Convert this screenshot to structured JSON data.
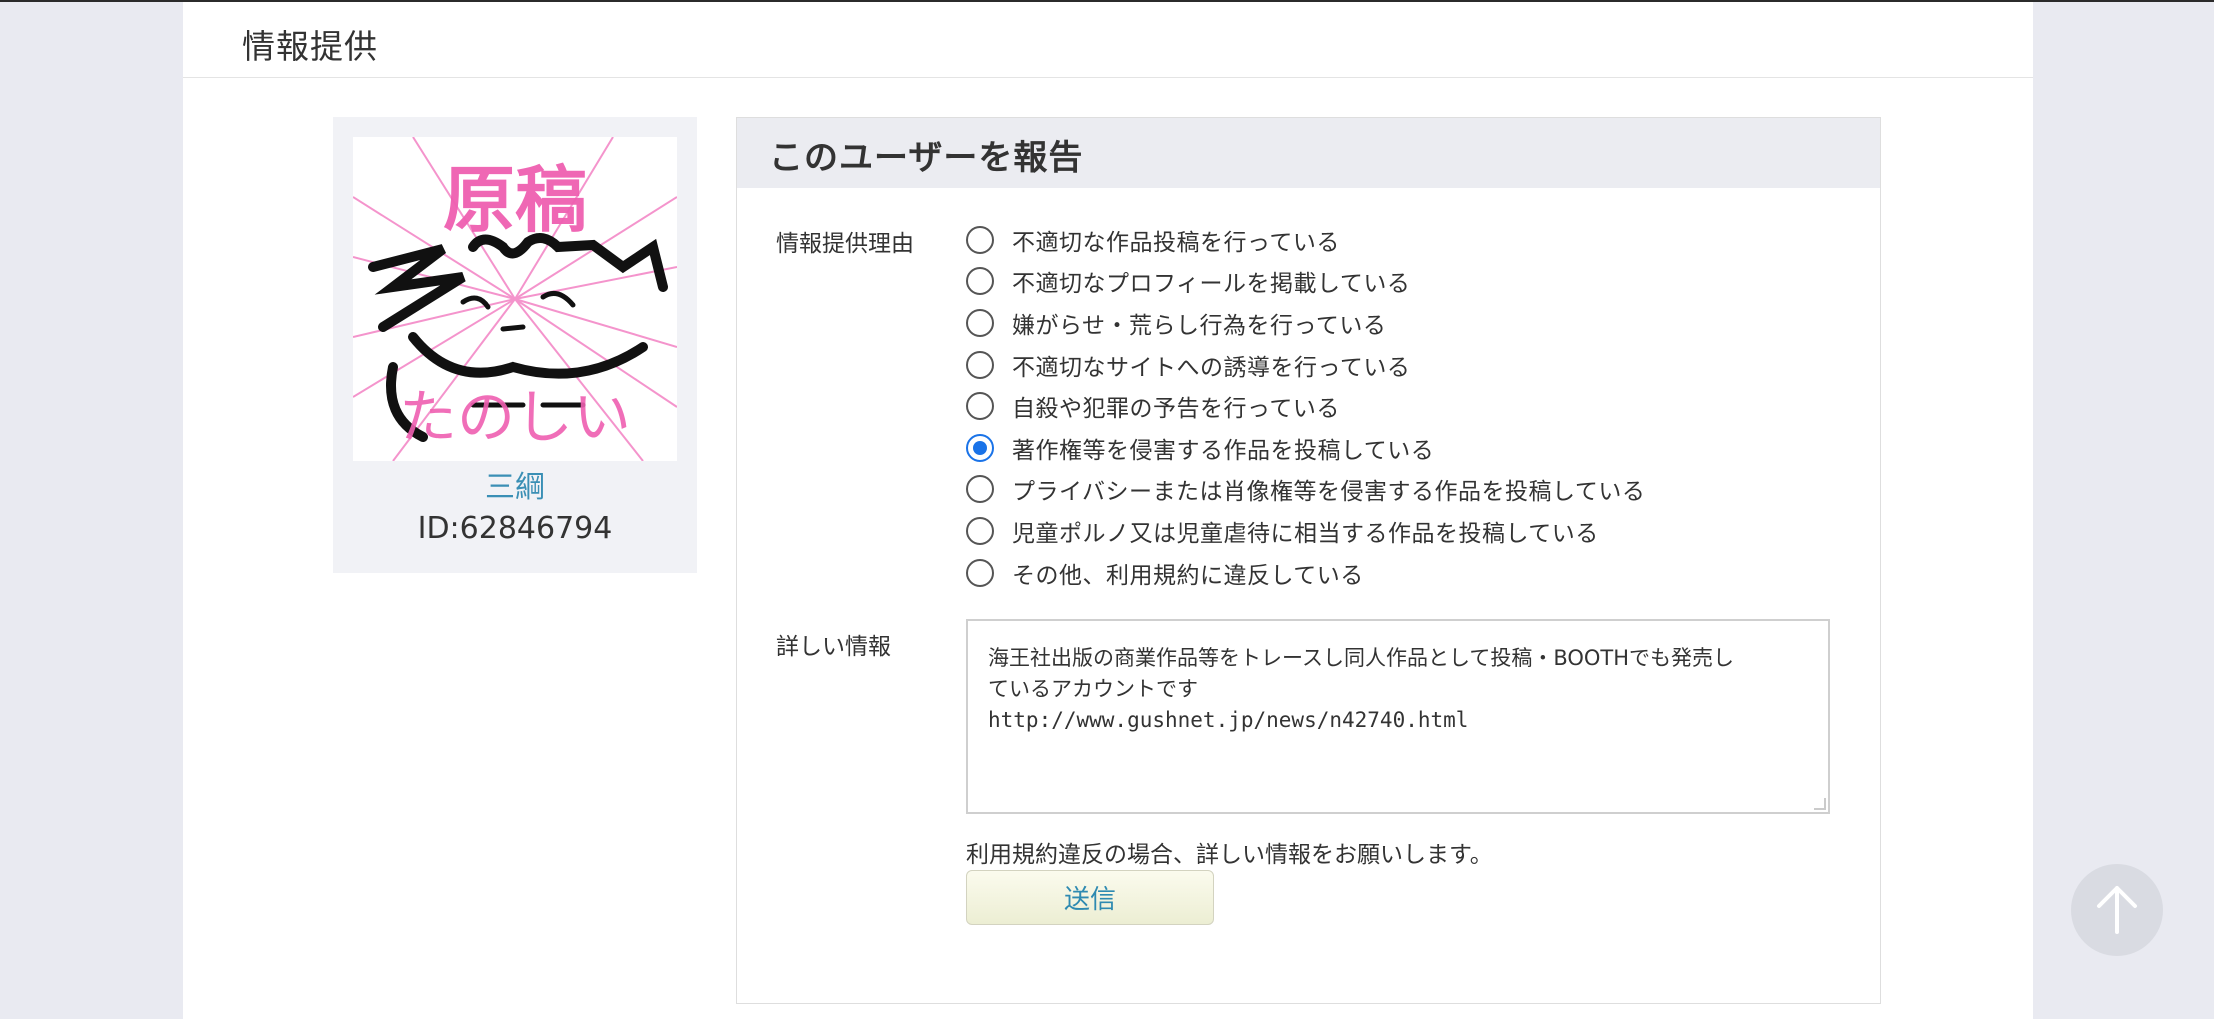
{
  "header": {
    "title": "情報提供"
  },
  "user": {
    "name": "三綱",
    "id_text": "ID:62846794",
    "avatar_text_top": "原稿",
    "avatar_text_bottom": "たのしい"
  },
  "report": {
    "title": "このユーザーを報告",
    "reason_label": "情報提供理由",
    "reasons": [
      {
        "label": "不適切な作品投稿を行っている",
        "checked": false
      },
      {
        "label": "不適切なプロフィールを掲載している",
        "checked": false
      },
      {
        "label": "嫌がらせ・荒らし行為を行っている",
        "checked": false
      },
      {
        "label": "不適切なサイトへの誘導を行っている",
        "checked": false
      },
      {
        "label": "自殺や犯罪の予告を行っている",
        "checked": false
      },
      {
        "label": "著作権等を侵害する作品を投稿している",
        "checked": true
      },
      {
        "label": "プライバシーまたは肖像権等を侵害する作品を投稿している",
        "checked": false
      },
      {
        "label": "児童ポルノ又は児童虐待に相当する作品を投稿している",
        "checked": false
      },
      {
        "label": "その他、利用規約に違反している",
        "checked": false
      }
    ],
    "detail_label": "詳しい情報",
    "detail_lines": [
      "海王社出版の商業作品等をトレースし同人作品として投稿・BOOTHでも発売し",
      "ているアカウントです",
      "http://www.gushnet.jp/news/n42740.html"
    ],
    "hint": "利用規約違反の場合、詳しい情報をお願いします。",
    "submit_label": "送信"
  },
  "colors": {
    "accent": "#1a73e8",
    "link": "#3a8fb5",
    "background": "#e9eaf1"
  },
  "icons": {
    "scroll_top": "arrow-up-icon"
  }
}
